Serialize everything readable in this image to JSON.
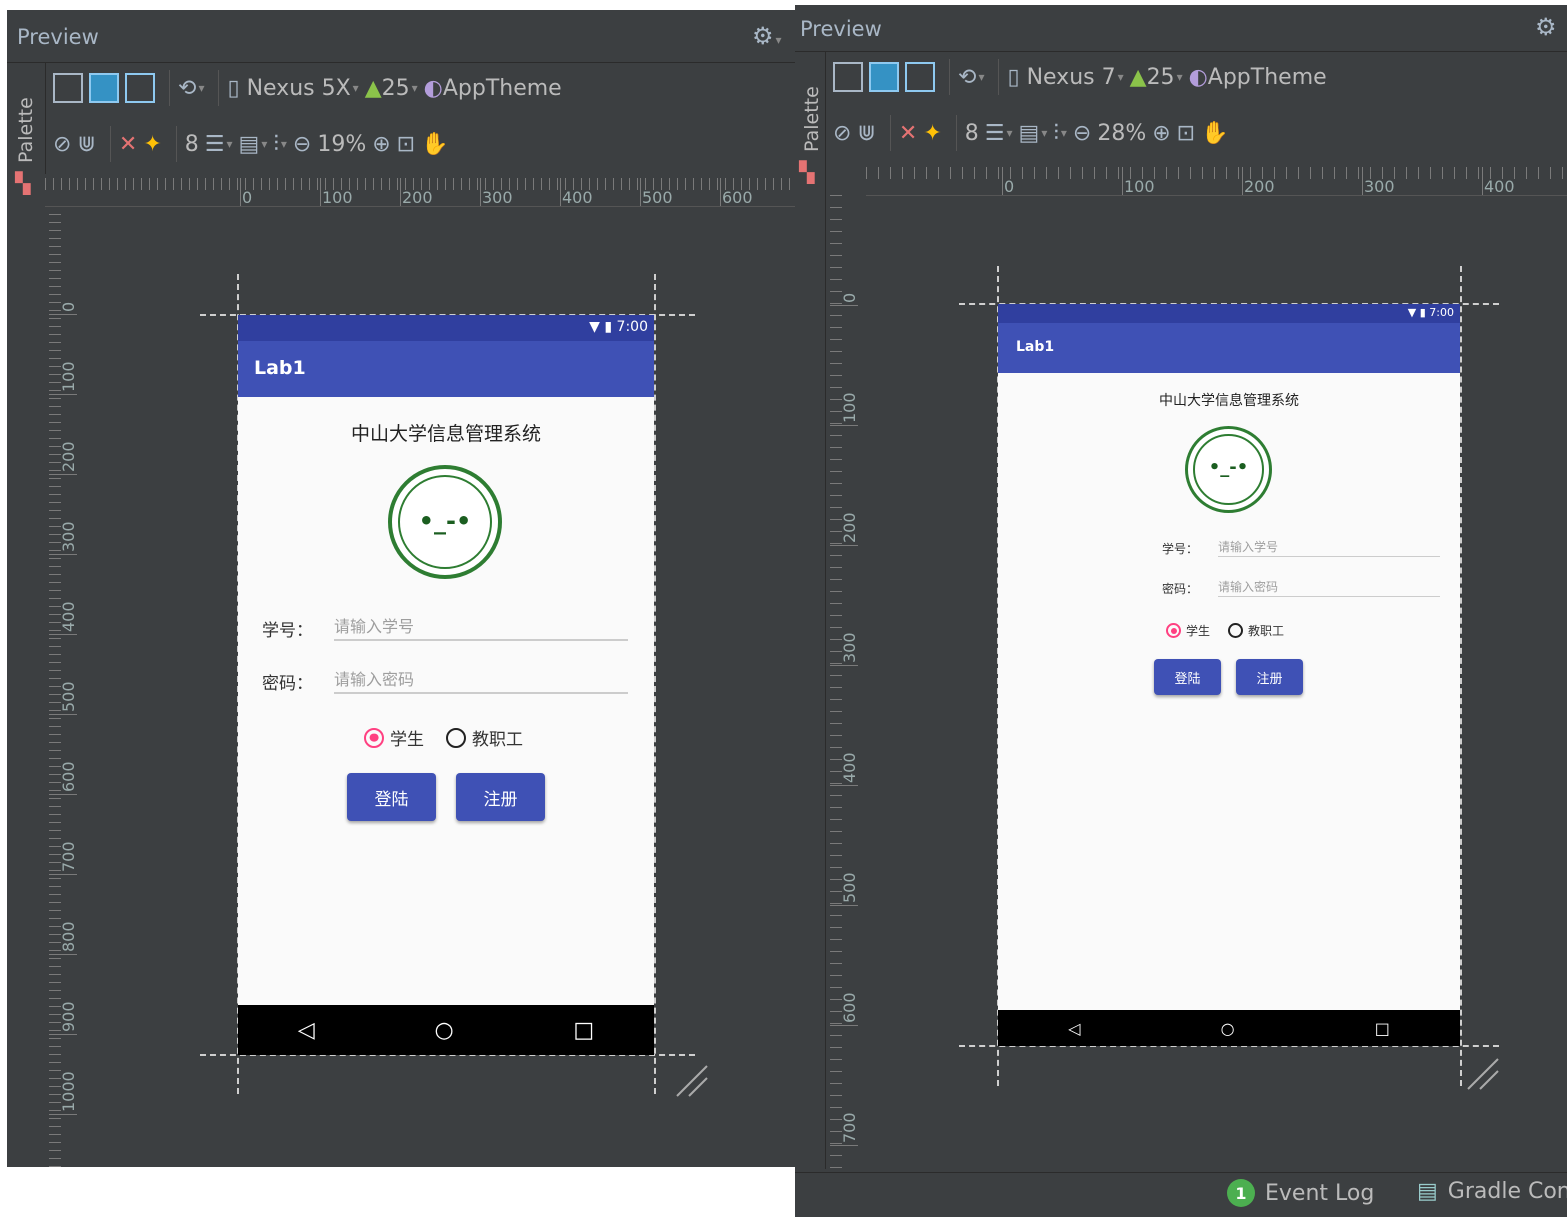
{
  "left": {
    "title": "Preview",
    "palette_label": "Palette",
    "device": "Nexus 5X",
    "api": "25",
    "theme": "AppTheme",
    "margin_value": "8",
    "zoom": "19%",
    "ruler_h": [
      "0",
      "100",
      "200",
      "300",
      "400",
      "500",
      "600"
    ],
    "ruler_v": [
      "0",
      "100",
      "200",
      "300",
      "400",
      "500",
      "600",
      "700",
      "800",
      "900",
      "1000",
      "00"
    ]
  },
  "right": {
    "title": "Preview",
    "palette_label": "Palette",
    "device": "Nexus 7",
    "api": "25",
    "theme": "AppTheme",
    "margin_value": "8",
    "zoom": "28%",
    "ruler_h": [
      "0",
      "100",
      "200",
      "300",
      "400"
    ],
    "ruler_v": [
      "0",
      "100",
      "200",
      "300",
      "400",
      "500",
      "600",
      "700"
    ]
  },
  "phone": {
    "time": "7:00",
    "app_title": "Lab1",
    "heading": "中山大学信息管理系统",
    "student_id_label": "学号：",
    "student_id_placeholder": "请输入学号",
    "password_label": "密码：",
    "password_placeholder": "请输入密码",
    "radio_student": "学生",
    "radio_staff": "教职工",
    "login_button": "登陆",
    "register_button": "注册",
    "logo_face": "•_-•"
  },
  "bottom": {
    "event_log_count": "1",
    "event_log": "Event Log",
    "gradle": "Gradle Con"
  },
  "colors": {
    "primary": "#3f51b5",
    "primary_dark": "#303f9f",
    "accent": "#ff4081",
    "logo_green": "#2e7d32",
    "ide_bg": "#3c3f41"
  }
}
